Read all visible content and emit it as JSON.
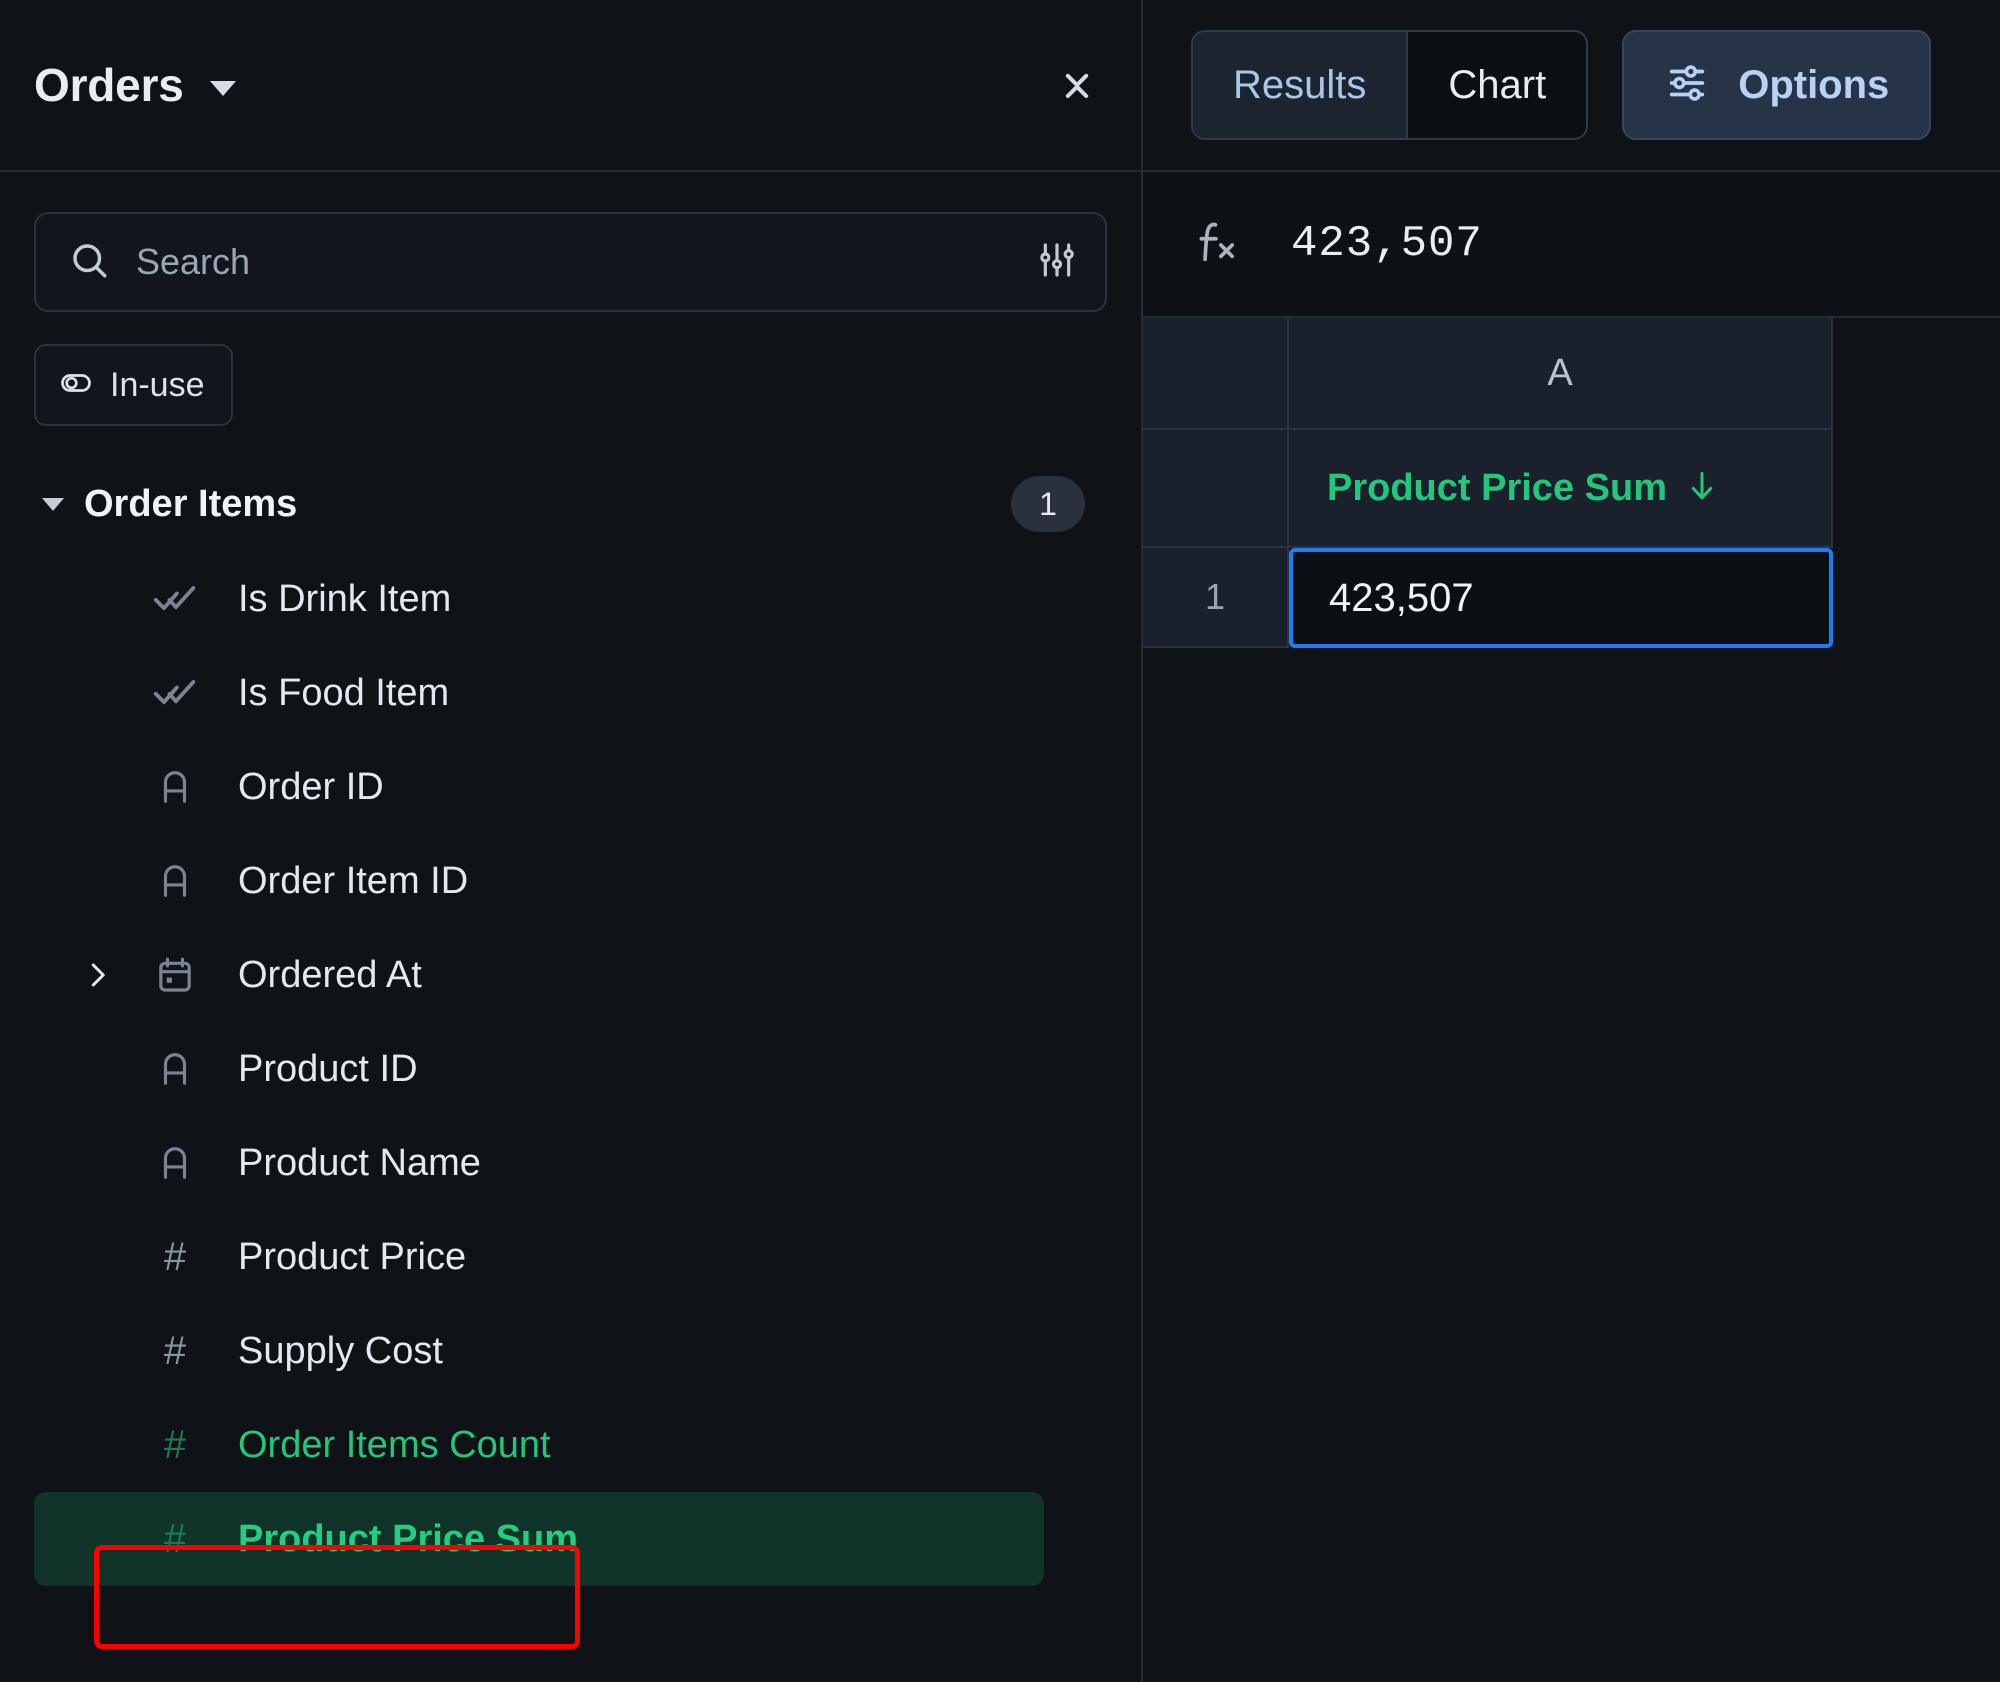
{
  "left_panel": {
    "title": "Orders",
    "title_caret_icon": "chevron-down-icon",
    "collapse_icon": "collapse-icon",
    "search": {
      "placeholder": "Search",
      "value": "",
      "search_icon": "search-icon",
      "filter_icon": "sliders-icon"
    },
    "chips": [
      {
        "label": "In-use",
        "icon": "toggle-icon"
      }
    ],
    "section": {
      "label": "Order Items",
      "badge": "1",
      "expanded": true
    },
    "fields": [
      {
        "label": "Is Drink Item",
        "icon": "boolean-check-icon",
        "type": "boolean",
        "metric": false,
        "expandable": false,
        "selected": false
      },
      {
        "label": "Is Food Item",
        "icon": "boolean-check-icon",
        "type": "boolean",
        "metric": false,
        "expandable": false,
        "selected": false
      },
      {
        "label": "Order ID",
        "icon": "text-type-icon",
        "type": "text",
        "metric": false,
        "expandable": false,
        "selected": false
      },
      {
        "label": "Order Item ID",
        "icon": "text-type-icon",
        "type": "text",
        "metric": false,
        "expandable": false,
        "selected": false
      },
      {
        "label": "Ordered At",
        "icon": "calendar-icon",
        "type": "date",
        "metric": false,
        "expandable": true,
        "selected": false
      },
      {
        "label": "Product ID",
        "icon": "text-type-icon",
        "type": "text",
        "metric": false,
        "expandable": false,
        "selected": false
      },
      {
        "label": "Product Name",
        "icon": "text-type-icon",
        "type": "text",
        "metric": false,
        "expandable": false,
        "selected": false
      },
      {
        "label": "Product Price",
        "icon": "number-hash-icon",
        "type": "number",
        "metric": false,
        "expandable": false,
        "selected": false
      },
      {
        "label": "Supply Cost",
        "icon": "number-hash-icon",
        "type": "number",
        "metric": false,
        "expandable": false,
        "selected": false
      },
      {
        "label": "Order Items Count",
        "icon": "number-hash-icon",
        "type": "number",
        "metric": true,
        "expandable": false,
        "selected": false
      },
      {
        "label": "Product Price Sum",
        "icon": "number-hash-icon",
        "type": "number",
        "metric": true,
        "expandable": false,
        "selected": true
      }
    ]
  },
  "right_panel": {
    "toolbar": {
      "tabs": [
        {
          "label": "Results",
          "active": false
        },
        {
          "label": "Chart",
          "active": true
        }
      ],
      "options_label": "Options",
      "options_icon": "sliders-icon"
    },
    "formula_bar": {
      "fx_icon": "fx-icon",
      "value": "423,507"
    },
    "grid": {
      "column_letters": [
        "A"
      ],
      "field_headers": [
        {
          "label": "Product Price Sum",
          "sort": "desc",
          "sort_icon": "arrow-down-icon"
        }
      ],
      "rows": [
        {
          "number": "1",
          "cells": [
            "423,507"
          ],
          "selected_cell_index": 0
        }
      ]
    }
  },
  "annotation": {
    "highlight_box_color": "#ff0000",
    "target": "Product Price Sum"
  },
  "colors": {
    "accent_green": "#1fc87a",
    "accent_blue": "#1c7ef5",
    "selection_bg": "#11342a",
    "panel_bg": "#0f1318",
    "header_bg": "#1b212c"
  }
}
